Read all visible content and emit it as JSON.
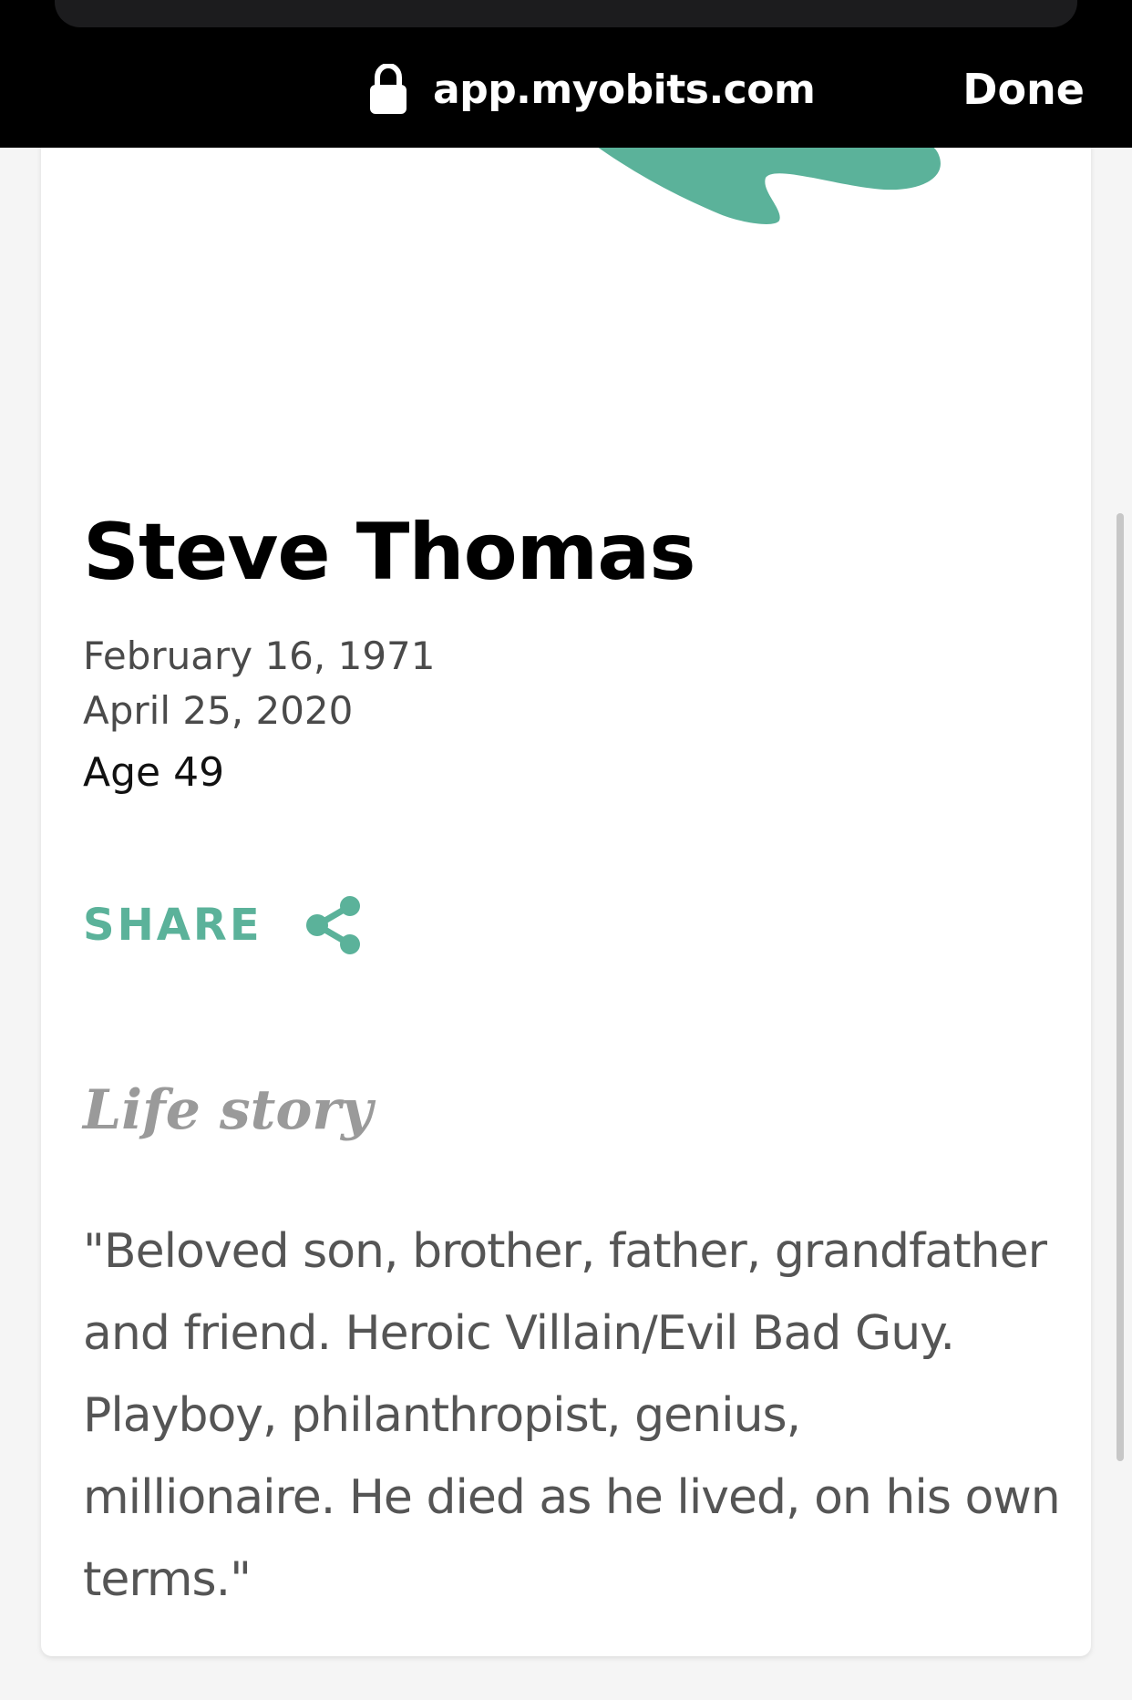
{
  "browser": {
    "url": "app.myobits.com",
    "done_label": "Done"
  },
  "obituary": {
    "name": "Steve Thomas",
    "birth_date": "February 16, 1971",
    "death_date": "April 25, 2020",
    "age": "Age 49",
    "share_label": "SHARE",
    "section_title": "Life story",
    "story_lines": [
      "\"Beloved son, brother, father, grandfather",
      "and friend. Heroic Villain/Evil Bad Guy.",
      "Playboy, philanthropist, genius,",
      "millionaire. He died as he lived, on his own",
      "terms.\""
    ]
  },
  "colors": {
    "accent": "#5bb29a",
    "topbar": "#000000",
    "background": "#f5f5f5"
  },
  "icons": {
    "lock": "lock-icon",
    "share": "share-icon"
  }
}
